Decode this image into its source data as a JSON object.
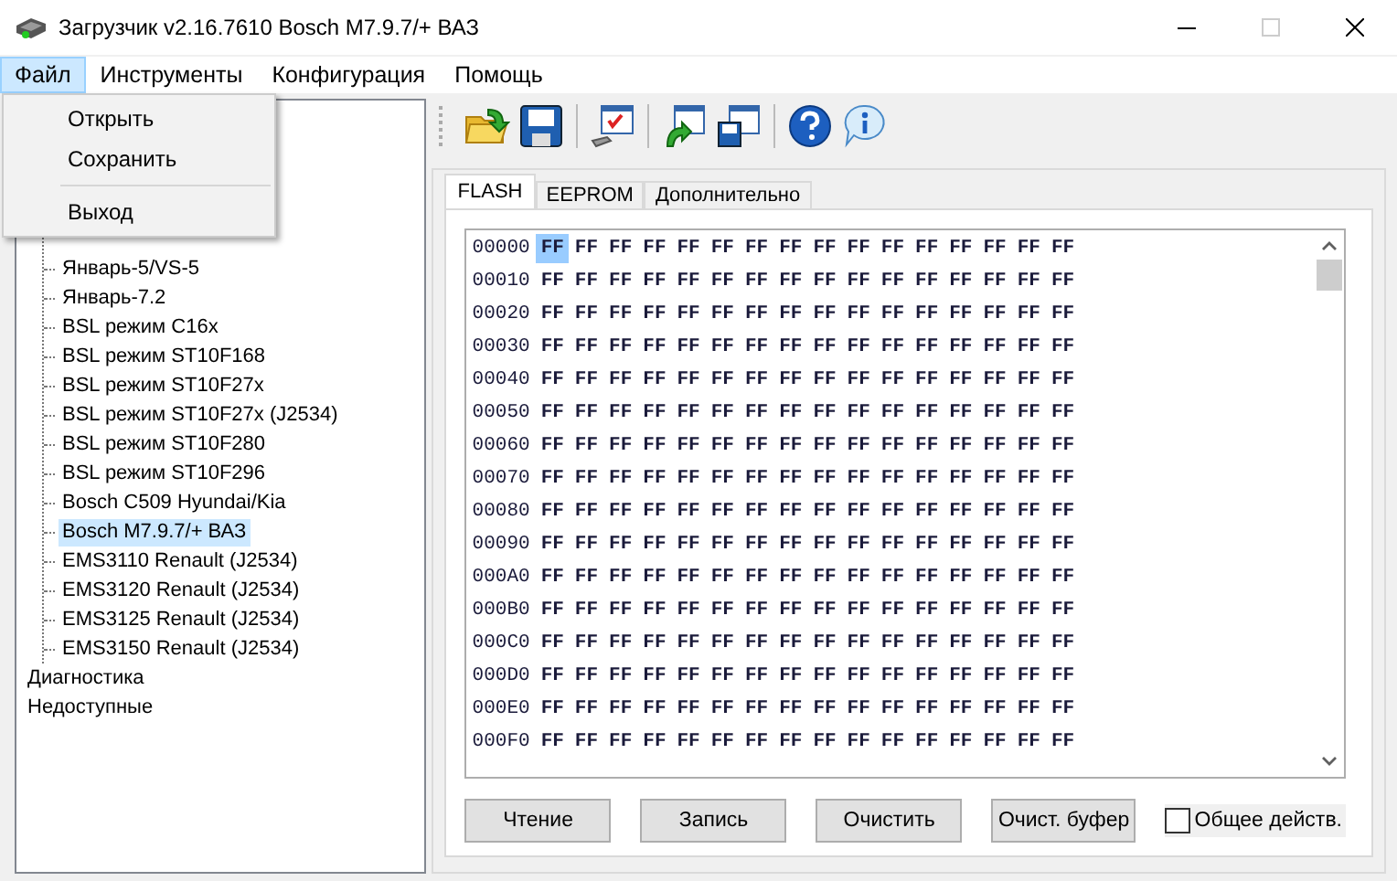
{
  "window": {
    "title": "Загрузчик v2.16.7610 Bosch M7.9.7/+ ВАЗ"
  },
  "menu_bar": [
    {
      "label": "Файл",
      "selected": true
    },
    {
      "label": "Инструменты",
      "selected": false
    },
    {
      "label": "Конфигурация",
      "selected": false
    },
    {
      "label": "Помощь",
      "selected": false
    }
  ],
  "file_menu": [
    {
      "kind": "item",
      "label": "Открыть"
    },
    {
      "kind": "item",
      "label": "Сохранить"
    },
    {
      "kind": "separator"
    },
    {
      "kind": "item",
      "label": "Выход"
    }
  ],
  "tree": [
    {
      "children": [
        {
          "label": "Январь-5/VS-5",
          "selected": false
        },
        {
          "label": "Январь-7.2",
          "selected": false
        },
        {
          "label": "BSL режим C16x",
          "selected": false
        },
        {
          "label": "BSL режим ST10F168",
          "selected": false
        },
        {
          "label": "BSL режим ST10F27x",
          "selected": false
        },
        {
          "label": "BSL режим ST10F27x (J2534)",
          "selected": false
        },
        {
          "label": "BSL режим ST10F280",
          "selected": false
        },
        {
          "label": "BSL режим ST10F296",
          "selected": false
        },
        {
          "label": "Bosch C509 Hyundai/Kia",
          "selected": false
        },
        {
          "label": "Bosch M7.9.7/+ ВАЗ",
          "selected": true
        },
        {
          "label": "EMS3110 Renault (J2534)",
          "selected": false
        },
        {
          "label": "EMS3120 Renault (J2534)",
          "selected": false
        },
        {
          "label": "EMS3125 Renault (J2534)",
          "selected": false
        },
        {
          "label": "EMS3150 Renault (J2534)",
          "selected": false
        }
      ]
    },
    {
      "label": "Диагностика",
      "selected": false
    },
    {
      "label": "Недоступные",
      "selected": false
    }
  ],
  "toolbar": [
    {
      "kind": "open"
    },
    {
      "kind": "save"
    },
    {
      "kind": "separator"
    },
    {
      "kind": "settings"
    },
    {
      "kind": "separator"
    },
    {
      "kind": "load"
    },
    {
      "kind": "store"
    },
    {
      "kind": "separator"
    },
    {
      "kind": "help"
    },
    {
      "kind": "info"
    }
  ],
  "tabs": [
    {
      "label": "FLASH",
      "selected": true
    },
    {
      "label": "EEPROM",
      "selected": false
    },
    {
      "label": "Дополнительно",
      "selected": false
    }
  ],
  "hex_rows": [
    {
      "address": "00000",
      "cursor": true,
      "bytes": [
        "FF",
        "FF",
        "FF",
        "FF",
        "FF",
        "FF",
        "FF",
        "FF",
        "FF",
        "FF",
        "FF",
        "FF",
        "FF",
        "FF",
        "FF",
        "FF"
      ]
    },
    {
      "address": "00010",
      "cursor": false,
      "bytes": [
        "FF",
        "FF",
        "FF",
        "FF",
        "FF",
        "FF",
        "FF",
        "FF",
        "FF",
        "FF",
        "FF",
        "FF",
        "FF",
        "FF",
        "FF",
        "FF"
      ]
    },
    {
      "address": "00020",
      "cursor": false,
      "bytes": [
        "FF",
        "FF",
        "FF",
        "FF",
        "FF",
        "FF",
        "FF",
        "FF",
        "FF",
        "FF",
        "FF",
        "FF",
        "FF",
        "FF",
        "FF",
        "FF"
      ]
    },
    {
      "address": "00030",
      "cursor": false,
      "bytes": [
        "FF",
        "FF",
        "FF",
        "FF",
        "FF",
        "FF",
        "FF",
        "FF",
        "FF",
        "FF",
        "FF",
        "FF",
        "FF",
        "FF",
        "FF",
        "FF"
      ]
    },
    {
      "address": "00040",
      "cursor": false,
      "bytes": [
        "FF",
        "FF",
        "FF",
        "FF",
        "FF",
        "FF",
        "FF",
        "FF",
        "FF",
        "FF",
        "FF",
        "FF",
        "FF",
        "FF",
        "FF",
        "FF"
      ]
    },
    {
      "address": "00050",
      "cursor": false,
      "bytes": [
        "FF",
        "FF",
        "FF",
        "FF",
        "FF",
        "FF",
        "FF",
        "FF",
        "FF",
        "FF",
        "FF",
        "FF",
        "FF",
        "FF",
        "FF",
        "FF"
      ]
    },
    {
      "address": "00060",
      "cursor": false,
      "bytes": [
        "FF",
        "FF",
        "FF",
        "FF",
        "FF",
        "FF",
        "FF",
        "FF",
        "FF",
        "FF",
        "FF",
        "FF",
        "FF",
        "FF",
        "FF",
        "FF"
      ]
    },
    {
      "address": "00070",
      "cursor": false,
      "bytes": [
        "FF",
        "FF",
        "FF",
        "FF",
        "FF",
        "FF",
        "FF",
        "FF",
        "FF",
        "FF",
        "FF",
        "FF",
        "FF",
        "FF",
        "FF",
        "FF"
      ]
    },
    {
      "address": "00080",
      "cursor": false,
      "bytes": [
        "FF",
        "FF",
        "FF",
        "FF",
        "FF",
        "FF",
        "FF",
        "FF",
        "FF",
        "FF",
        "FF",
        "FF",
        "FF",
        "FF",
        "FF",
        "FF"
      ]
    },
    {
      "address": "00090",
      "cursor": false,
      "bytes": [
        "FF",
        "FF",
        "FF",
        "FF",
        "FF",
        "FF",
        "FF",
        "FF",
        "FF",
        "FF",
        "FF",
        "FF",
        "FF",
        "FF",
        "FF",
        "FF"
      ]
    },
    {
      "address": "000A0",
      "cursor": false,
      "bytes": [
        "FF",
        "FF",
        "FF",
        "FF",
        "FF",
        "FF",
        "FF",
        "FF",
        "FF",
        "FF",
        "FF",
        "FF",
        "FF",
        "FF",
        "FF",
        "FF"
      ]
    },
    {
      "address": "000B0",
      "cursor": false,
      "bytes": [
        "FF",
        "FF",
        "FF",
        "FF",
        "FF",
        "FF",
        "FF",
        "FF",
        "FF",
        "FF",
        "FF",
        "FF",
        "FF",
        "FF",
        "FF",
        "FF"
      ]
    },
    {
      "address": "000C0",
      "cursor": false,
      "bytes": [
        "FF",
        "FF",
        "FF",
        "FF",
        "FF",
        "FF",
        "FF",
        "FF",
        "FF",
        "FF",
        "FF",
        "FF",
        "FF",
        "FF",
        "FF",
        "FF"
      ]
    },
    {
      "address": "000D0",
      "cursor": false,
      "bytes": [
        "FF",
        "FF",
        "FF",
        "FF",
        "FF",
        "FF",
        "FF",
        "FF",
        "FF",
        "FF",
        "FF",
        "FF",
        "FF",
        "FF",
        "FF",
        "FF"
      ]
    },
    {
      "address": "000E0",
      "cursor": false,
      "bytes": [
        "FF",
        "FF",
        "FF",
        "FF",
        "FF",
        "FF",
        "FF",
        "FF",
        "FF",
        "FF",
        "FF",
        "FF",
        "FF",
        "FF",
        "FF",
        "FF"
      ]
    },
    {
      "address": "000F0",
      "cursor": false,
      "bytes": [
        "FF",
        "FF",
        "FF",
        "FF",
        "FF",
        "FF",
        "FF",
        "FF",
        "FF",
        "FF",
        "FF",
        "FF",
        "FF",
        "FF",
        "FF",
        "FF"
      ]
    }
  ],
  "buttons": [
    "Чтение",
    "Запись",
    "Очистить",
    "Очист. буфер"
  ],
  "common_action": {
    "label": "Общее действ.",
    "checked": false
  }
}
